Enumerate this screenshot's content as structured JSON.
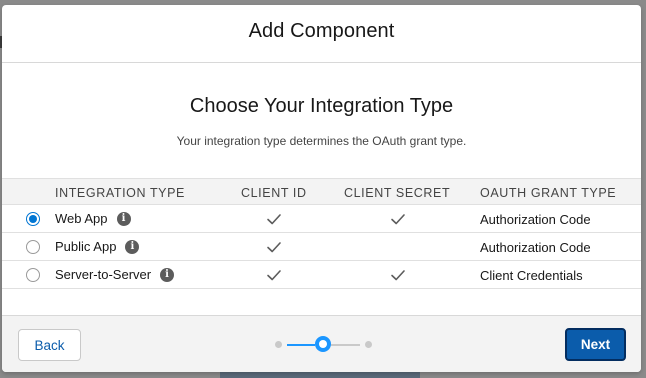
{
  "modal": {
    "title": "Add Component"
  },
  "body": {
    "heading": "Choose Your Integration Type",
    "subheading": "Your integration type determines the OAuth grant type."
  },
  "table": {
    "headers": [
      "Integration Type",
      "Client ID",
      "Client Secret",
      "OAuth Grant Type"
    ],
    "rows": [
      {
        "type": "Web App",
        "client_id": true,
        "client_secret": true,
        "grant": "Authorization Code",
        "selected": true
      },
      {
        "type": "Public App",
        "client_id": true,
        "client_secret": false,
        "grant": "Authorization Code",
        "selected": false
      },
      {
        "type": "Server-to-Server",
        "client_id": true,
        "client_secret": true,
        "grant": "Client Credentials",
        "selected": false
      }
    ],
    "info_icon": "info-icon",
    "check_icon": "check-icon"
  },
  "footer": {
    "back_label": "Back",
    "next_label": "Next",
    "steps_total": 3,
    "current_step": 2
  },
  "colors": {
    "brand": "#0b5cab",
    "accent": "#1b96ff",
    "radio": "#0176d3"
  }
}
